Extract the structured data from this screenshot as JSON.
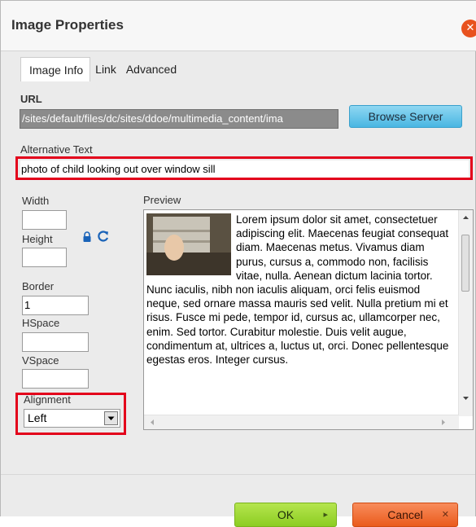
{
  "dialog": {
    "title": "Image Properties",
    "close_icon": "close-icon"
  },
  "tabs": [
    {
      "label": "Image Info",
      "active": true
    },
    {
      "label": "Link",
      "active": false
    },
    {
      "label": "Advanced",
      "active": false
    }
  ],
  "url": {
    "label": "URL",
    "value": "/sites/default/files/dc/sites/ddoe/multimedia_content/ima"
  },
  "browse_button": "Browse Server",
  "alt_text": {
    "label": "Alternative Text",
    "value": "photo of child looking out over window sill"
  },
  "width": {
    "label": "Width",
    "value": ""
  },
  "height": {
    "label": "Height",
    "value": ""
  },
  "border": {
    "label": "Border",
    "value": "1"
  },
  "hspace": {
    "label": "HSpace",
    "value": ""
  },
  "vspace": {
    "label": "VSpace",
    "value": ""
  },
  "alignment": {
    "label": "Alignment",
    "value": "Left"
  },
  "preview": {
    "label": "Preview",
    "text": "Lorem ipsum dolor sit amet, consectetuer adipiscing elit. Maecenas feugiat consequat diam. Maecenas metus. Vivamus diam purus, cursus a, commodo non, facilisis vitae, nulla. Aenean dictum lacinia tortor. Nunc iaculis, nibh non iaculis aliquam, orci felis euismod neque, sed ornare massa mauris sed velit. Nulla pretium mi et risus. Fusce mi pede, tempor id, cursus ac, ullamcorper nec, enim. Sed tortor. Curabitur molestie. Duis velit augue, condimentum at, ultrices a, luctus ut, orci. Donec pellentesque egestas eros. Integer cursus."
  },
  "buttons": {
    "ok": "OK",
    "cancel": "Cancel"
  },
  "colors": {
    "highlight": "#e3001b",
    "ok": "#8ccd22",
    "cancel": "#ea5b1d",
    "browse": "#49b6e2"
  }
}
